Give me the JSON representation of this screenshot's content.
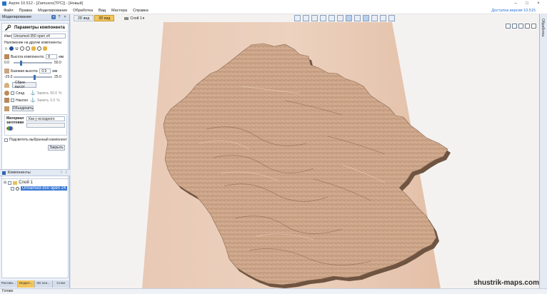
{
  "window": {
    "title": "Aspire 10.512 - [Zamuxos(TPC)] - [Новый]",
    "controls": [
      "–",
      "□",
      "×"
    ]
  },
  "menu": {
    "items": [
      "Файл",
      "Правка",
      "Моделирование",
      "Обработка",
      "Вид",
      "Мастера",
      "Справка"
    ],
    "upgrade_link": "Доступна версия 10.515"
  },
  "left_panel": {
    "header": "Моделирование",
    "header_buttons": [
      "?",
      "×"
    ],
    "component_properties": {
      "title": "Параметры компонента",
      "name_label": "Имя",
      "name_value": "Unnamed-350 open z4",
      "blend_label": "Наложение на другие компоненты",
      "height_label": "Высота компонента:",
      "height_value": "8",
      "height_unit": "мм",
      "height_min": "0.0",
      "height_max": "50.0",
      "base_label": "Базовая высота:",
      "base_value": "0.5",
      "base_unit": "мм",
      "base_min": "-25.0",
      "base_max": "25.0",
      "reset_button": "Сброс высот",
      "fade_label": "Спад",
      "fade_lock": "Замять",
      "fade_value": "50.0",
      "fade_unit": "%",
      "tilt_label": "Наклон",
      "tilt_lock": "Замять",
      "tilt_value": "0.0",
      "tilt_unit": "%",
      "volume_button": "Объединить",
      "material_label": "Материал заготовки",
      "material_value": "Как у исходного",
      "highlight_label": "Подсветить выбранный компонент",
      "close_button": "Закрыть"
    },
    "components_header": "Компоненты",
    "tree": {
      "layer": "Слой 1",
      "item": "Unnamed-350 open z4"
    },
    "bottom_tabs": [
      "Рисова...",
      "Модел...",
      "3D кон...",
      "Слои"
    ],
    "active_tab": 1
  },
  "viewport": {
    "tabs": [
      "2D вид",
      "3D вид"
    ],
    "active_tab": 1,
    "layer_select": "Слой 1",
    "watermark": "shustrik-maps.com",
    "colors": {
      "background": "#f4f2f1",
      "material": "#e3bda3",
      "relief": "#c9a083",
      "shadow": "#6e5441"
    }
  },
  "right_strip": {
    "label": "Обработка"
  },
  "status": {
    "text": "Готово"
  }
}
